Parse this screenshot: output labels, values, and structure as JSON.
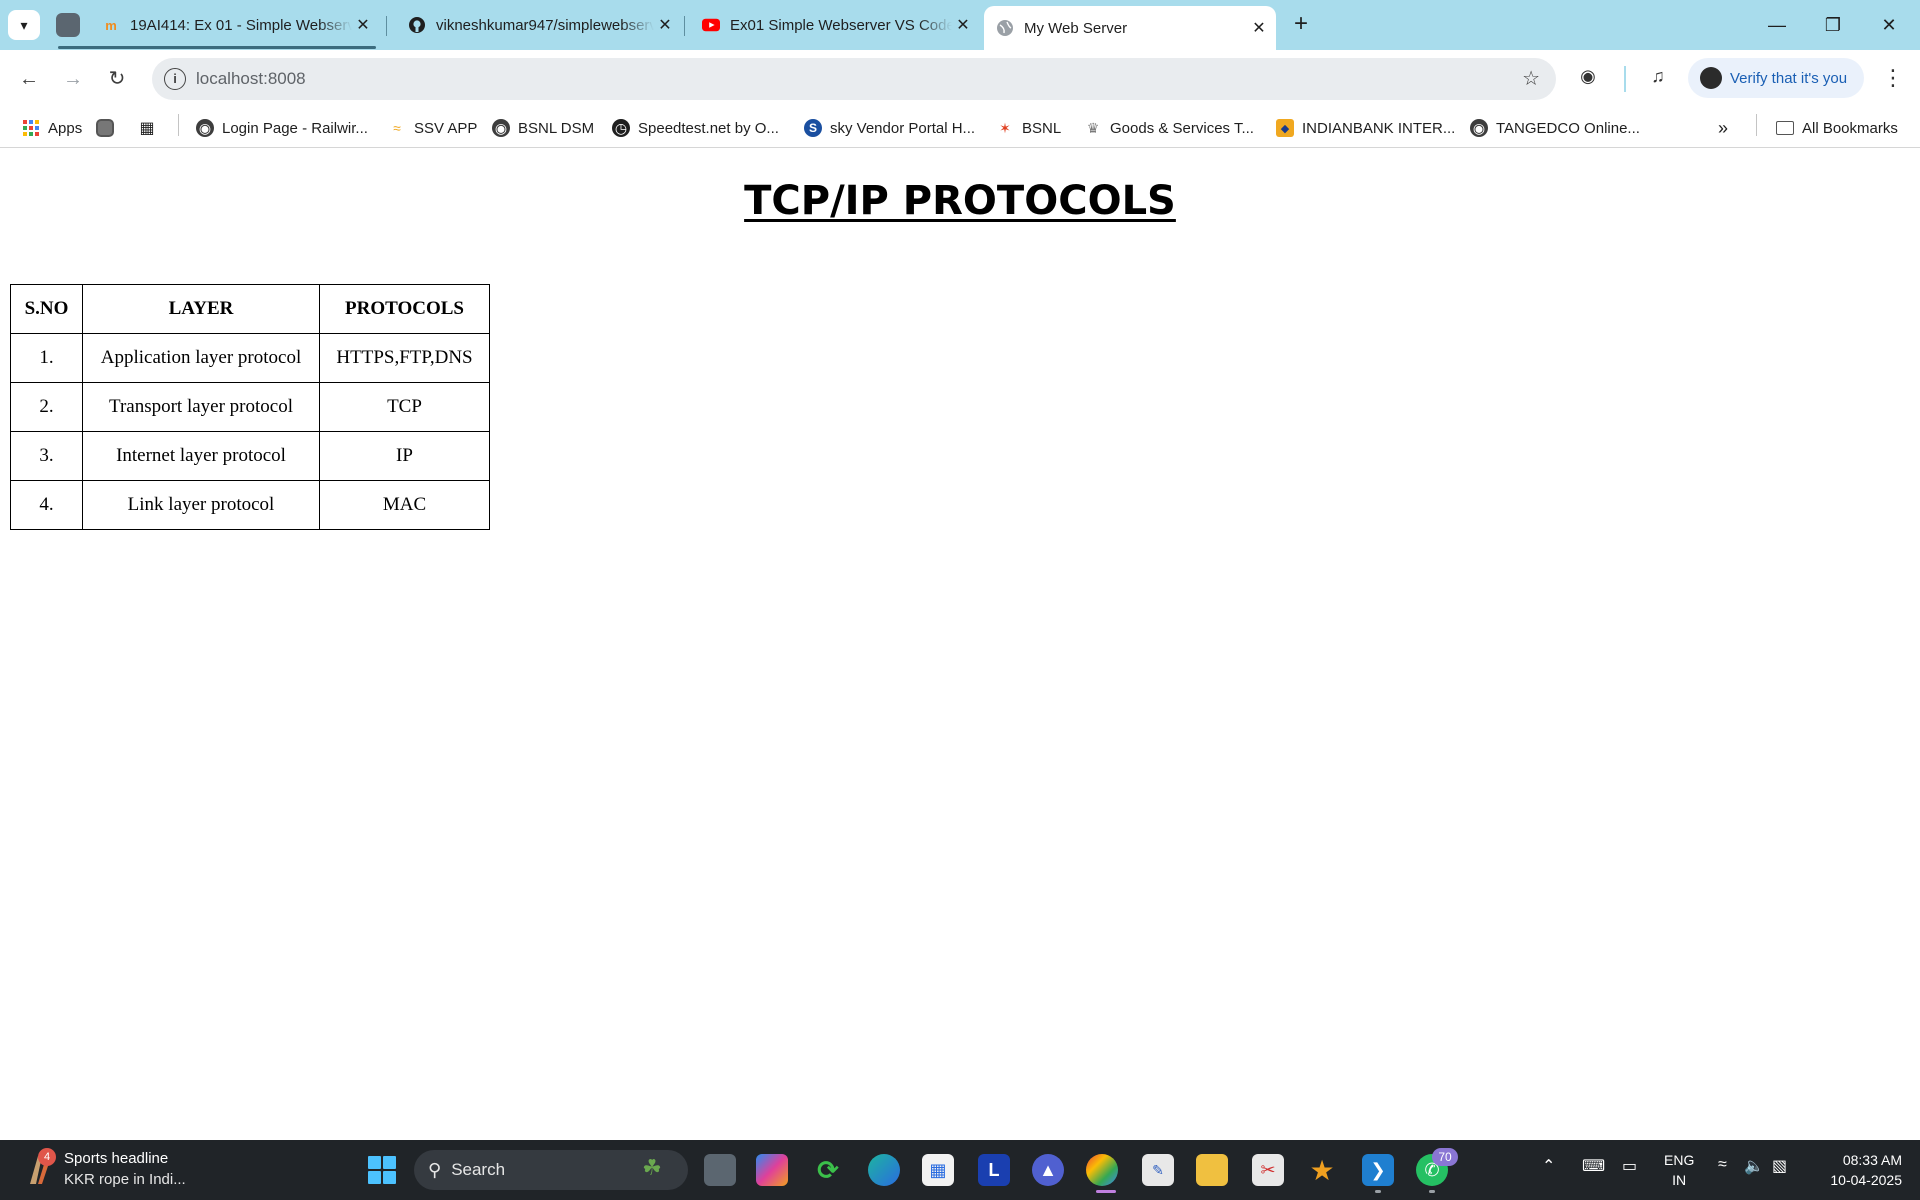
{
  "tabs": [
    {
      "title": "19AI414: Ex 01 - Simple Webserver",
      "icon": "moodle-icon"
    },
    {
      "title": "vikneshkumar947/simplewebserver",
      "icon": "github-icon"
    },
    {
      "title": "Ex01 Simple Webserver VS Code",
      "icon": "youtube-icon"
    },
    {
      "title": "My Web Server",
      "icon": "globe-icon"
    }
  ],
  "address": {
    "url": "localhost:8008"
  },
  "profile": {
    "verify_label": "Verify that it's you"
  },
  "bookmarks": [
    {
      "label": "Apps"
    },
    {
      "label": "Login Page - Railwir..."
    },
    {
      "label": "SSV APP"
    },
    {
      "label": "BSNL DSM"
    },
    {
      "label": "Speedtest.net by O..."
    },
    {
      "label": "sky Vendor Portal H..."
    },
    {
      "label": "BSNL"
    },
    {
      "label": "Goods & Services T..."
    },
    {
      "label": "INDIANBANK INTER..."
    },
    {
      "label": "TANGEDCO Online..."
    },
    {
      "label": "All Bookmarks"
    }
  ],
  "page": {
    "heading": "TCP/IP PROTOCOLS",
    "table": {
      "headers": [
        "S.NO",
        "LAYER",
        "PROTOCOLS"
      ],
      "rows": [
        [
          "1.",
          "Application layer protocol",
          "HTTPS,FTP,DNS"
        ],
        [
          "2.",
          "Transport layer protocol",
          "TCP"
        ],
        [
          "3.",
          "Internet layer protocol",
          "IP"
        ],
        [
          "4.",
          "Link layer protocol",
          "MAC"
        ]
      ]
    }
  },
  "taskbar": {
    "news_badge": "4",
    "news_title": "Sports headline",
    "news_sub": "KKR rope in Indi...",
    "search_label": "Search",
    "app_badge": "70",
    "lang_top": "ENG",
    "lang_bottom": "IN",
    "time": "08:33 AM",
    "date": "10-04-2025"
  },
  "colors": {
    "tabstrip": "#a8dcec",
    "taskbar": "#202428",
    "accent": "#1a5fb4"
  }
}
